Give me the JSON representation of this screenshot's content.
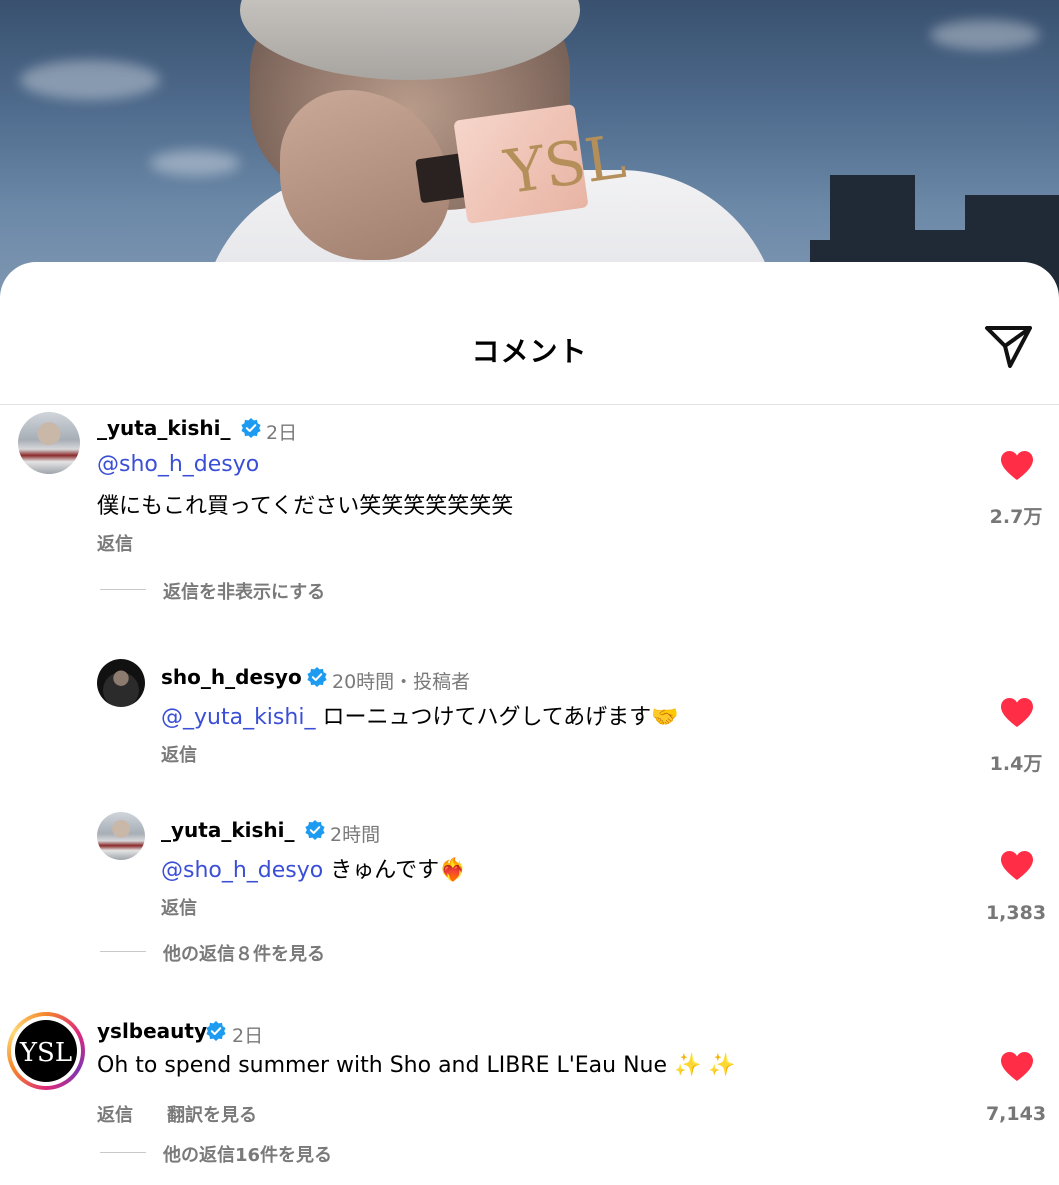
{
  "header": {
    "title": "コメント"
  },
  "comments": [
    {
      "username": "_yuta_kishi_",
      "time": "2日",
      "mention": "@sho_h_desyo",
      "text": "僕にもこれ買ってください笑笑笑笑笑笑笑",
      "reply_label": "返信",
      "likes": "2.7万",
      "thread_toggle": "返信を非表示にする",
      "replies": [
        {
          "username": "sho_h_desyo",
          "time": "20時間・投稿者",
          "mention": "@_yuta_kishi_",
          "text": " ローニュつけてハグしてあげます🤝",
          "reply_label": "返信",
          "likes": "1.4万"
        },
        {
          "username": "_yuta_kishi_",
          "time": "2時間",
          "mention": "@sho_h_desyo",
          "text": " きゅんです❤️‍🔥",
          "reply_label": "返信",
          "likes": "1,383"
        }
      ],
      "more_replies": "他の返信８件を見る"
    },
    {
      "username": "yslbeauty",
      "time": "2日",
      "text": "Oh to spend summer with Sho and LIBRE L'Eau Nue ✨ ✨",
      "reply_label": "返信",
      "translate_label": "翻訳を見る",
      "likes": "7,143",
      "more_replies": "他の返信16件を見る",
      "avatar_logo": "YSL"
    }
  ],
  "colors": {
    "heart": "#ff2d46",
    "mention": "#3b4fd6",
    "verified": "#1d9bf0"
  },
  "icons": {
    "share": "paper-plane-icon",
    "like": "heart-icon",
    "verified": "verified-badge-icon"
  }
}
